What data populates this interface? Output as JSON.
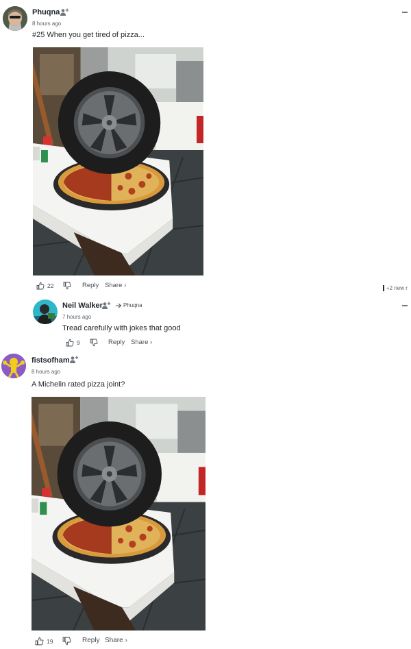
{
  "comments": [
    {
      "username": "Phuqna",
      "time": "8 hours ago",
      "text": "#25 When you get tired of pizza...",
      "likes": "22",
      "reply_label": "Reply",
      "share_label": "Share ›"
    },
    {
      "username": "Neil Walker",
      "reply_to": "Phuqna",
      "time": "7 hours ago",
      "text": "Tread carefully with jokes that good",
      "likes": "9",
      "reply_label": "Reply",
      "share_label": "Share ›"
    },
    {
      "username": "fistsofham",
      "time": "8 hours ago",
      "text": "A Michelin rated pizza joint?",
      "likes": "19",
      "reply_label": "Reply",
      "share_label": "Share ›"
    }
  ],
  "new_replies": "+2 new r",
  "icons": {
    "follow": "add-user-icon",
    "like": "thumbs-up-icon",
    "dislike": "thumbs-down-icon",
    "reply_arrow": "reply-arrow-icon",
    "collapse": "minus-icon"
  }
}
